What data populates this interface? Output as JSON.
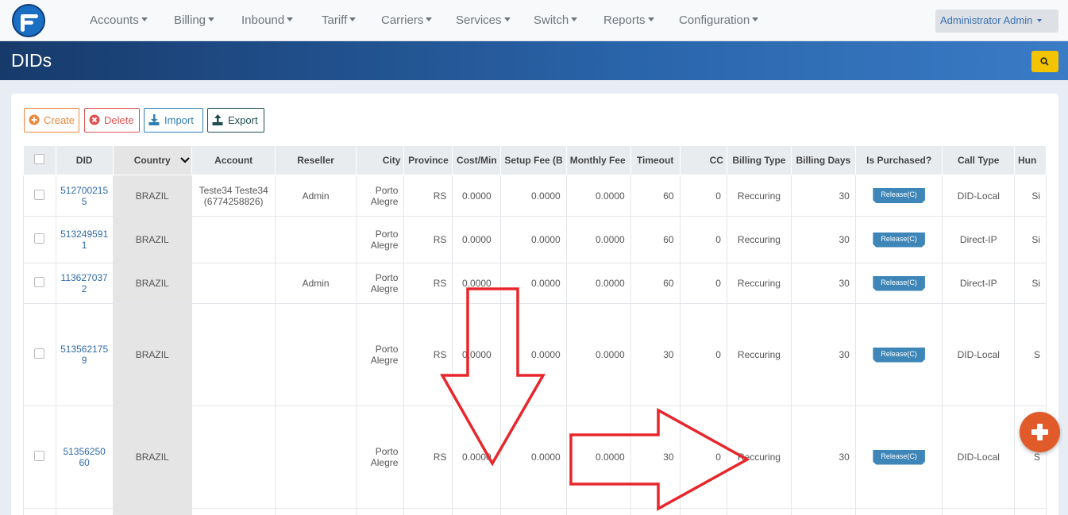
{
  "nav": {
    "menu": [
      {
        "label": "Accounts"
      },
      {
        "label": "Billing"
      },
      {
        "label": "Inbound"
      },
      {
        "label": "Tariff"
      },
      {
        "label": "Carriers"
      },
      {
        "label": "Services"
      },
      {
        "label": "Switch"
      },
      {
        "label": "Reports"
      },
      {
        "label": "Configuration"
      }
    ],
    "user": "Administrator Admin"
  },
  "page": {
    "title": "DIDs"
  },
  "actions": {
    "create": "Create",
    "delete": "Delete",
    "import": "Import",
    "export": "Export"
  },
  "colors": {
    "create": "#f0883b",
    "delete": "#e05252",
    "import": "#2f7fb3",
    "export": "#1f4d4d",
    "badge": "#3d86b7",
    "fab": "#e15a2a",
    "annotation": "#e8262b"
  },
  "table": {
    "columns": [
      "DID",
      "Country",
      "Account",
      "Reseller",
      "City",
      "Province",
      "Cost/Min",
      "Setup Fee (B",
      "Monthly Fee",
      "Timeout",
      "CC",
      "Billing Type",
      "Billing Days",
      "Is Purchased?",
      "Call Type",
      "Hun"
    ],
    "rows": [
      {
        "did": "512700215 5",
        "country": "BRAZIL",
        "account": "Teste34 Teste34 (6774258826)",
        "reseller": "Admin",
        "city": "Porto Alegre",
        "province": "RS",
        "cost": "0.0000",
        "setup": "0.0000",
        "monthly": "0.0000",
        "timeout": "60",
        "cc": "0",
        "billing_type": "Reccuring",
        "billing_days": "30",
        "purchased": "Release(C)",
        "call_type": "DID-Local",
        "hunt": "Si"
      },
      {
        "did": "513249591 1",
        "country": "BRAZIL",
        "account": "",
        "reseller": "",
        "city": "Porto Alegre",
        "province": "RS",
        "cost": "0.0000",
        "setup": "0.0000",
        "monthly": "0.0000",
        "timeout": "60",
        "cc": "0",
        "billing_type": "Reccuring",
        "billing_days": "30",
        "purchased": "Release(C)",
        "call_type": "Direct-IP",
        "hunt": "Si"
      },
      {
        "did": "113627037 2",
        "country": "BRAZIL",
        "account": "",
        "reseller": "Admin",
        "city": "Porto Alegre",
        "province": "RS",
        "cost": "0.0000",
        "setup": "0.0000",
        "monthly": "0.0000",
        "timeout": "60",
        "cc": "0",
        "billing_type": "Reccuring",
        "billing_days": "30",
        "purchased": "Release(C)",
        "call_type": "Direct-IP",
        "hunt": "Si"
      },
      {
        "did": "513562175 9",
        "country": "BRAZIL",
        "account": "",
        "reseller": "",
        "city": "Porto Alegre",
        "province": "RS",
        "cost": "0.0000",
        "setup": "0.0000",
        "monthly": "0.0000",
        "timeout": "30",
        "cc": "0",
        "billing_type": "Reccuring",
        "billing_days": "30",
        "purchased": "Release(C)",
        "call_type": "DID-Local",
        "hunt": "S"
      },
      {
        "did": "51356250 60",
        "country": "BRAZIL",
        "account": "",
        "reseller": "",
        "city": "Porto Alegre",
        "province": "RS",
        "cost": "0.0000",
        "setup": "0.0000",
        "monthly": "0.0000",
        "timeout": "30",
        "cc": "0",
        "billing_type": "Reccuring",
        "billing_days": "30",
        "purchased": "Release(C)",
        "call_type": "DID-Local",
        "hunt": "S"
      }
    ]
  }
}
